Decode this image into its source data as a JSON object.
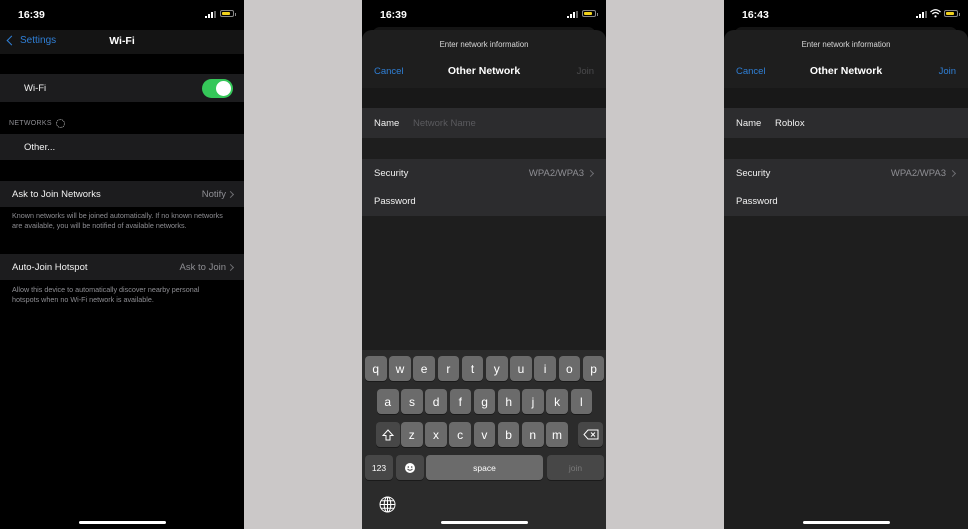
{
  "panels": [
    {
      "status": {
        "time": "16:39",
        "wifi": false
      },
      "nav": {
        "back_label": "Settings",
        "title": "Wi-Fi"
      },
      "wifi_row": {
        "label": "Wi-Fi",
        "toggle_on": true
      },
      "networks_header": "NETWORKS",
      "other_label": "Other...",
      "ask_row": {
        "label": "Ask to Join Networks",
        "value": "Notify"
      },
      "ask_footnote": "Known networks will be joined automatically. If no known networks are available, you will be notified of available networks.",
      "hotspot_row": {
        "label": "Auto-Join Hotspot",
        "value": "Ask to Join"
      },
      "hotspot_footnote": "Allow this device to automatically discover nearby personal hotspots when no Wi-Fi network is available."
    },
    {
      "status": {
        "time": "16:39",
        "wifi": false
      },
      "prompt": "Enter network information",
      "cancel_label": "Cancel",
      "title": "Other Network",
      "join_label": "Join",
      "join_enabled": false,
      "name_label": "Name",
      "name_placeholder": "Network Name",
      "name_value": "",
      "security_label": "Security",
      "security_value": "WPA2/WPA3",
      "password_label": "Password",
      "keyboard": {
        "row1": [
          "q",
          "w",
          "e",
          "r",
          "t",
          "y",
          "u",
          "i",
          "o",
          "p"
        ],
        "row2": [
          "a",
          "s",
          "d",
          "f",
          "g",
          "h",
          "j",
          "k",
          "l"
        ],
        "row3": [
          "z",
          "x",
          "c",
          "v",
          "b",
          "n",
          "m"
        ],
        "numbers_label": "123",
        "space_label": "space",
        "return_label": "join"
      }
    },
    {
      "status": {
        "time": "16:43",
        "wifi": true
      },
      "prompt": "Enter network information",
      "cancel_label": "Cancel",
      "title": "Other Network",
      "join_label": "Join",
      "join_enabled": true,
      "name_label": "Name",
      "name_value": "Roblox",
      "security_label": "Security",
      "security_value": "WPA2/WPA3",
      "password_label": "Password"
    }
  ],
  "colors": {
    "accent_blue": "#2f7fd6",
    "toggle_green": "#35c759",
    "battery_yellow": "#f2d21b",
    "gap_gray": "#cbc8c8"
  }
}
